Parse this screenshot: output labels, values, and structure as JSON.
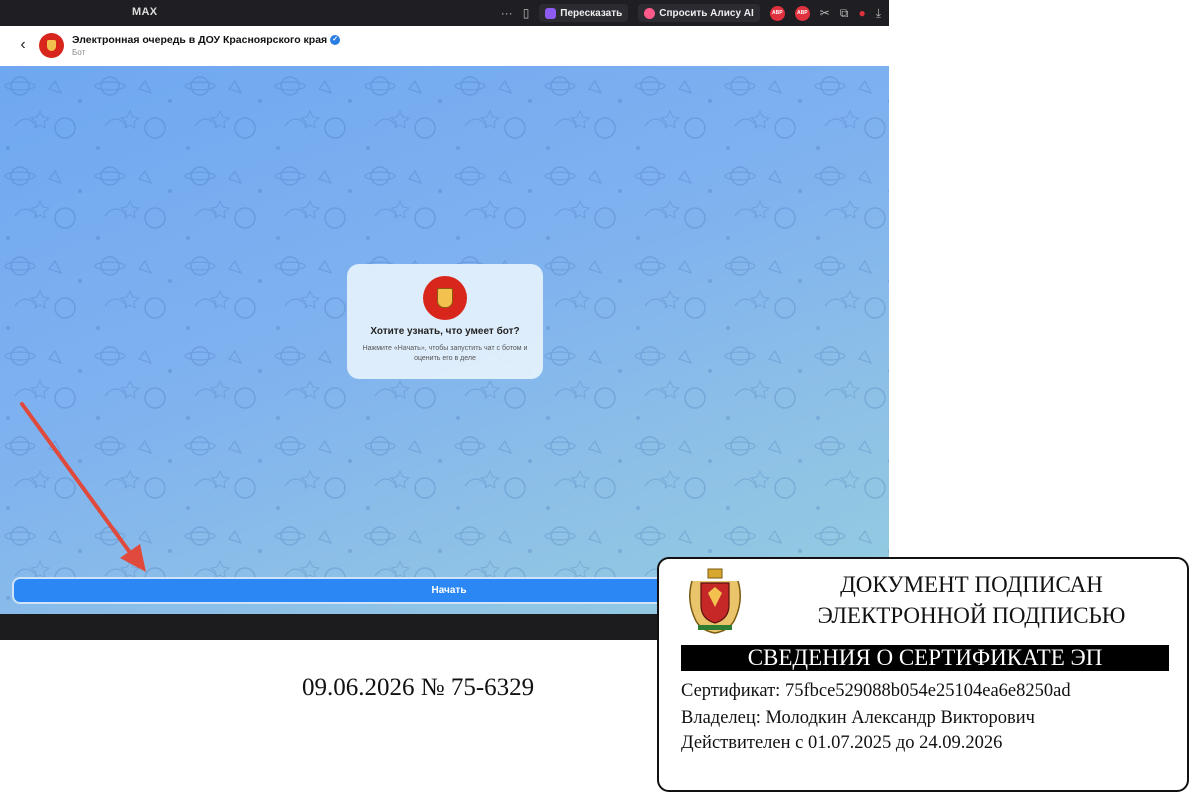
{
  "browser": {
    "tab_title": "MAX",
    "summarize_label": "Пересказать",
    "ask_alice_label": "Спросить Алису AI",
    "adblock_1": "ABP",
    "adblock_2": "ABP"
  },
  "chat_header": {
    "bot_name": "Электронная очередь в ДОУ Красноярского края",
    "bot_type": "Бот"
  },
  "intro_card": {
    "title": "Хотите узнать, что умеет бот?",
    "text": "Нажмите «Начать», чтобы запустить чат с ботом и оценить его в деле"
  },
  "start_button": "Начать",
  "document": {
    "number_line": "09.06.2026 № 75-6329"
  },
  "signature_stamp": {
    "heading_line1": "ДОКУМЕНТ ПОДПИСАН",
    "heading_line2": "ЭЛЕКТРОННОЙ ПОДПИСЬЮ",
    "band": "СВЕДЕНИЯ О СЕРТИФИКАТЕ ЭП",
    "certificate": "Сертификат: 75fbce529088b054e25104ea6e8250ad",
    "owner": "Владелец: Молодкин Александр Викторович",
    "valid": "Действителен с 01.07.2025 до 24.09.2026"
  },
  "colors": {
    "accent_button": "#2b87f3",
    "avatar_red": "#d9261c",
    "verified_blue": "#2a7de1",
    "annotation_arrow": "#e04a3c"
  },
  "icons": [
    "back-arrow-icon",
    "verified-icon",
    "bookmark-icon",
    "more-icon",
    "download-icon",
    "extensions-icon"
  ]
}
